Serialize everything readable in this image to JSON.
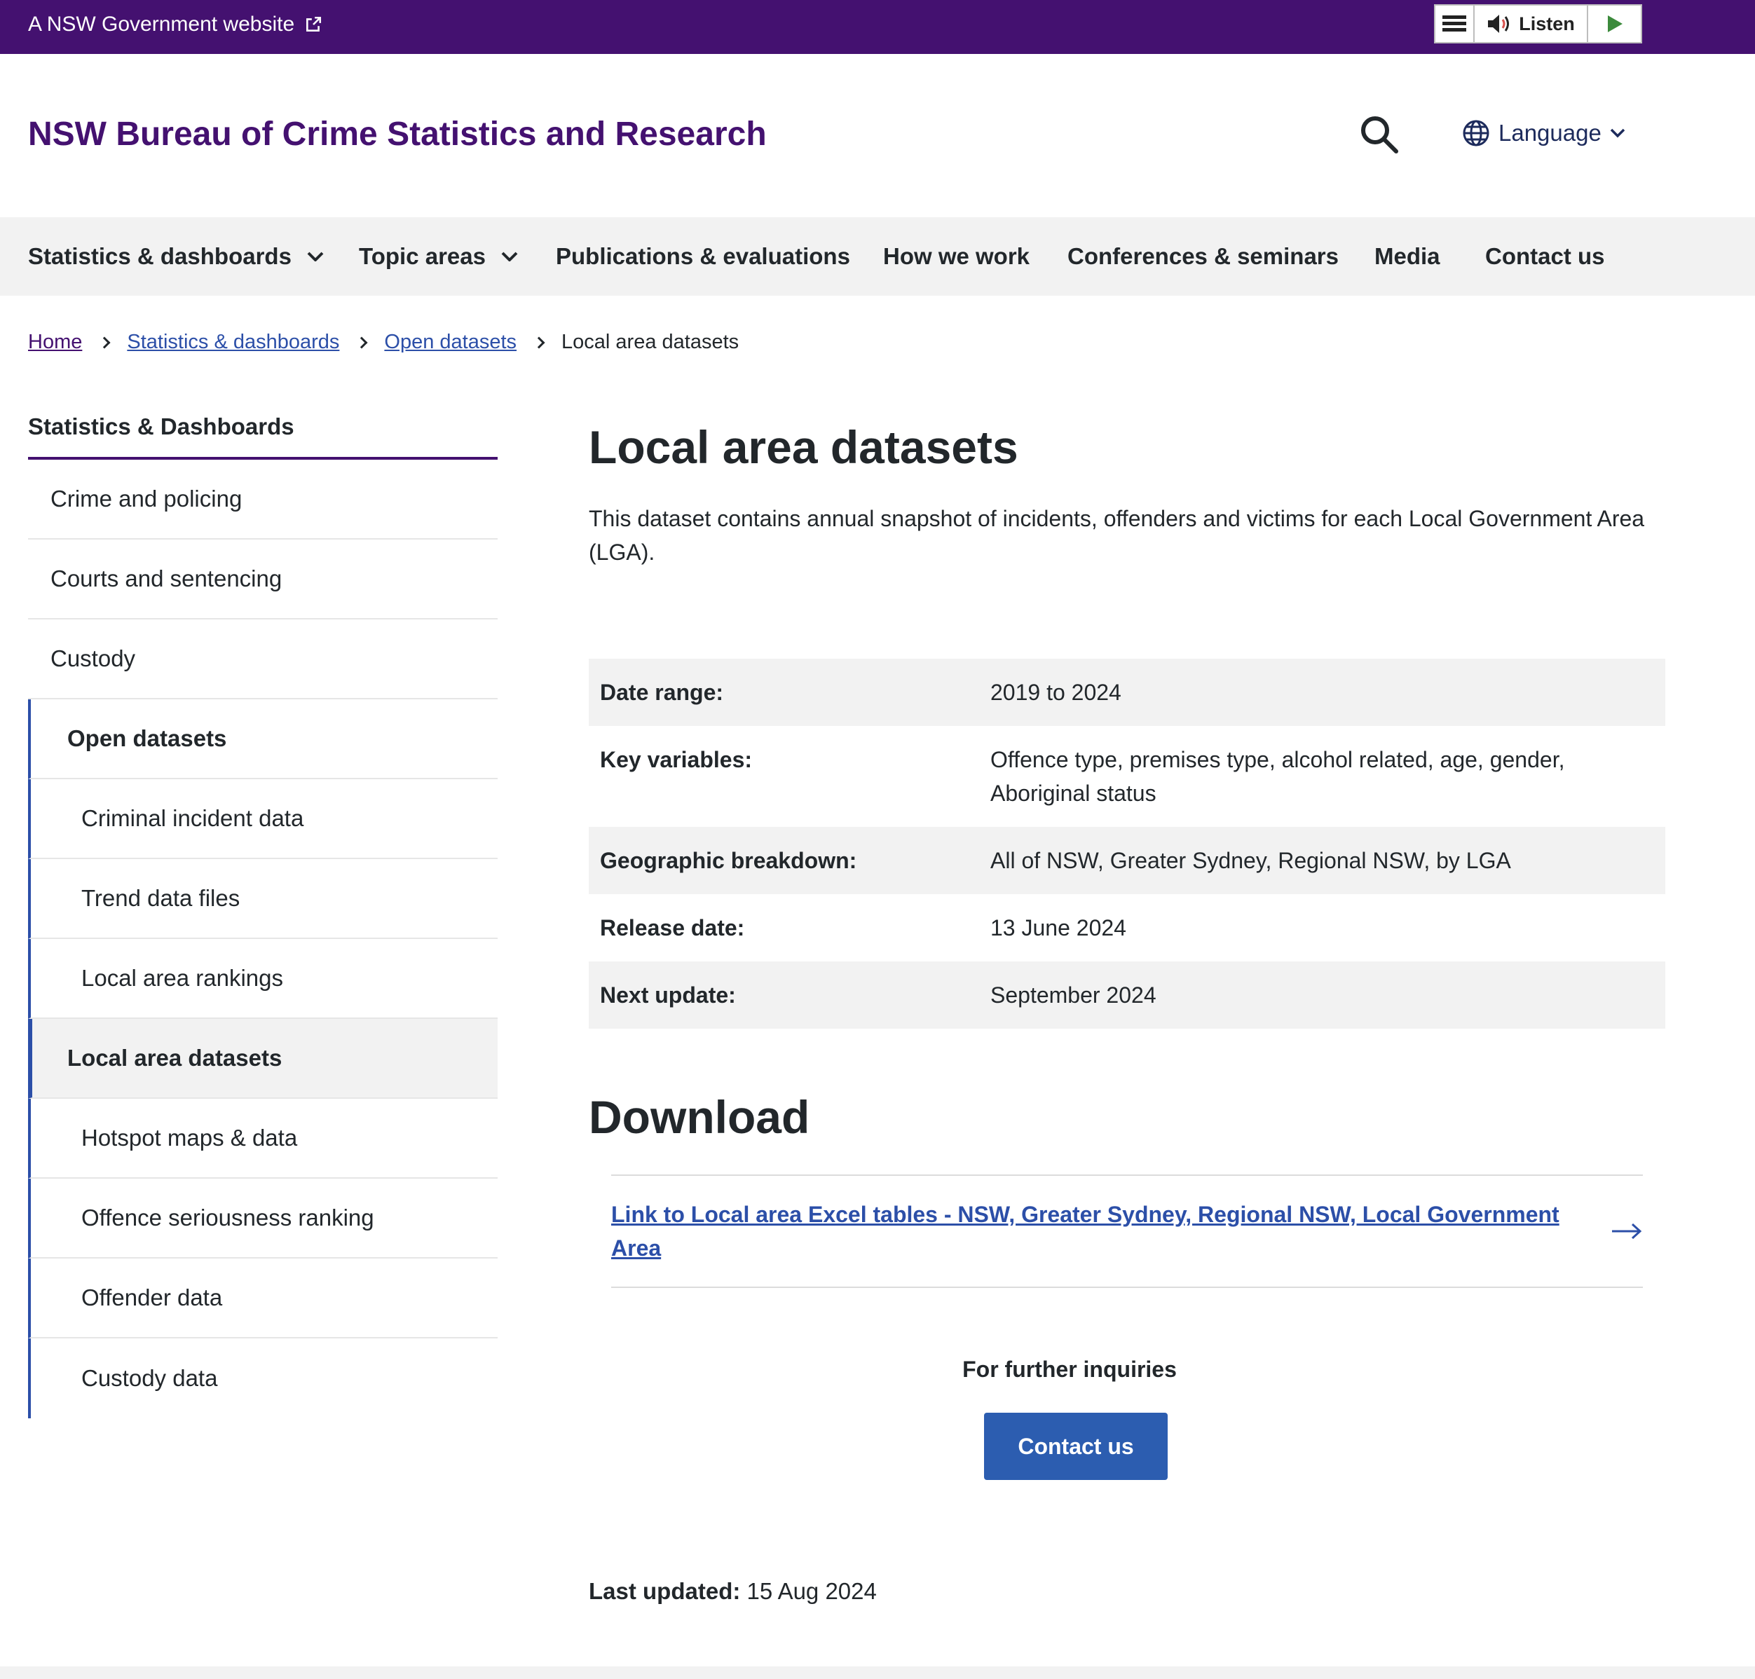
{
  "masthead": {
    "gov_label": "A NSW Government website",
    "listen_label": "Listen"
  },
  "header": {
    "site_title": "NSW Bureau of Crime Statistics and Research",
    "language_label": "Language"
  },
  "nav": {
    "items": [
      {
        "label": "Statistics & dashboards"
      },
      {
        "label": "Topic areas"
      },
      {
        "label": "Publications & evaluations"
      },
      {
        "label": "How we work"
      },
      {
        "label": "Conferences & seminars"
      },
      {
        "label": "Media"
      },
      {
        "label": "Contact us"
      }
    ]
  },
  "breadcrumb": {
    "items": [
      "Home",
      "Statistics & dashboards",
      "Open datasets"
    ],
    "current": "Local area datasets"
  },
  "sidebar": {
    "heading": "Statistics & Dashboards",
    "items": [
      {
        "label": "Crime and policing"
      },
      {
        "label": "Courts and sentencing"
      },
      {
        "label": "Custody"
      },
      {
        "label": "Open datasets"
      },
      {
        "label": "Criminal incident data"
      },
      {
        "label": "Trend data files"
      },
      {
        "label": "Local area rankings"
      },
      {
        "label": "Local area datasets"
      },
      {
        "label": "Hotspot maps & data"
      },
      {
        "label": "Offence seriousness ranking"
      },
      {
        "label": "Offender data"
      },
      {
        "label": "Custody data"
      }
    ]
  },
  "main": {
    "title": "Local area datasets",
    "intro": "This dataset contains annual snapshot of incidents, offenders and victims for each Local Government Area (LGA).",
    "meta": [
      {
        "key": "Date range:",
        "value": "2019 to 2024"
      },
      {
        "key": "Key variables:",
        "value": "Offence type, premises type, alcohol related, age, gender, Aboriginal status"
      },
      {
        "key": "Geographic breakdown:",
        "value": "All of NSW, Greater Sydney, Regional NSW, by LGA"
      },
      {
        "key": "Release date:",
        "value": "13 June 2024"
      },
      {
        "key": "Next update:",
        "value": "September 2024"
      }
    ],
    "download_heading": "Download",
    "download_link": "Link to Local area Excel tables - NSW, Greater Sydney, Regional NSW, Local Government Area",
    "inquiries_label": "For further inquiries",
    "contact_button": "Contact us",
    "last_updated_label": "Last updated:",
    "last_updated_value": "15 Aug 2024"
  },
  "colors": {
    "brand_purple": "#441170",
    "link_blue": "#2c4fa8",
    "button_blue": "#2c5db0"
  }
}
